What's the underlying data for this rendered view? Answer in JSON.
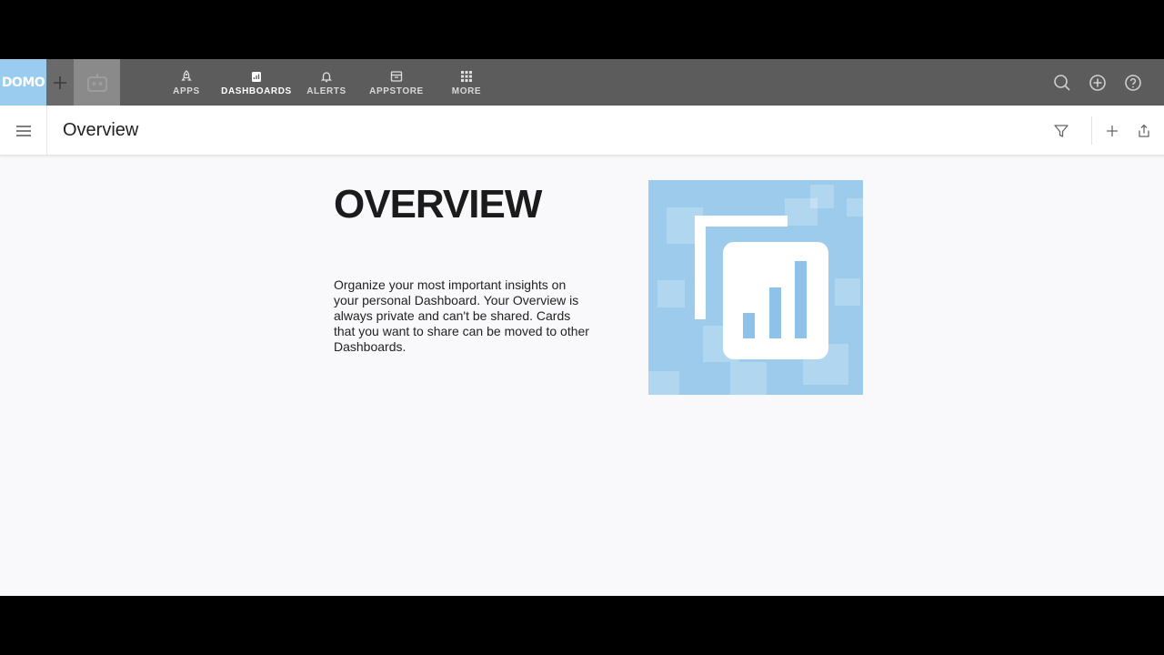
{
  "brand": {
    "logo_text": "DOMO",
    "accent": "#99ccee"
  },
  "topnav": {
    "items": [
      {
        "label": "APPS",
        "icon": "rocket-icon",
        "active": false
      },
      {
        "label": "DASHBOARDS",
        "icon": "dashboard-icon",
        "active": true
      },
      {
        "label": "ALERTS",
        "icon": "bell-icon",
        "active": false
      },
      {
        "label": "APPSTORE",
        "icon": "store-icon",
        "active": false
      },
      {
        "label": "MORE",
        "icon": "grid-icon",
        "active": false
      }
    ],
    "right_icons": [
      "search-icon",
      "plus-circle-icon",
      "help-icon"
    ]
  },
  "page": {
    "title": "Overview"
  },
  "content": {
    "heading": "OVERVIEW",
    "description": "Organize your most important insights on your personal Dashboard. Your Overview is always private and can't be shared. Cards that you want to share can be moved to other Dashboards."
  }
}
